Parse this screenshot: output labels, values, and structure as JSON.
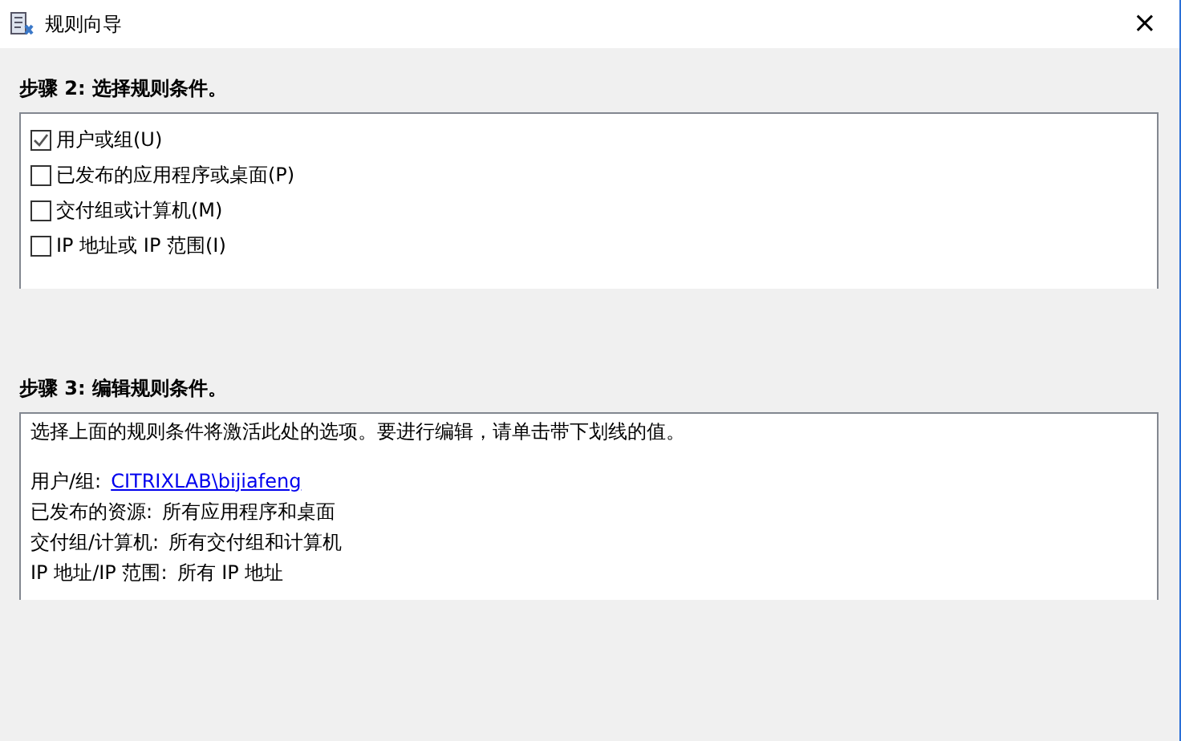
{
  "window": {
    "title": "规则向导",
    "close": "×"
  },
  "step2": {
    "heading": "步骤 2: 选择规则条件。",
    "conditions": [
      {
        "label": "用户或组(U)",
        "checked": true
      },
      {
        "label": "已发布的应用程序或桌面(P)",
        "checked": false
      },
      {
        "label": "交付组或计算机(M)",
        "checked": false
      },
      {
        "label": "IP 地址或 IP 范围(I)",
        "checked": false
      }
    ]
  },
  "step3": {
    "heading": "步骤 3: 编辑规则条件。",
    "intro": "选择上面的规则条件将激活此处的选项。要进行编辑，请单击带下划线的值。",
    "details": [
      {
        "label": "用户/组:",
        "value": "CITRIXLAB\\bijiafeng",
        "kind": "link"
      },
      {
        "label": "已发布的资源:",
        "value": "所有应用程序和桌面",
        "kind": "text"
      },
      {
        "label": "交付组/计算机:",
        "value": "所有交付组和计算机",
        "kind": "text"
      },
      {
        "label": "IP 地址/IP 范围:",
        "value": "所有 IP 地址",
        "kind": "text"
      }
    ]
  }
}
